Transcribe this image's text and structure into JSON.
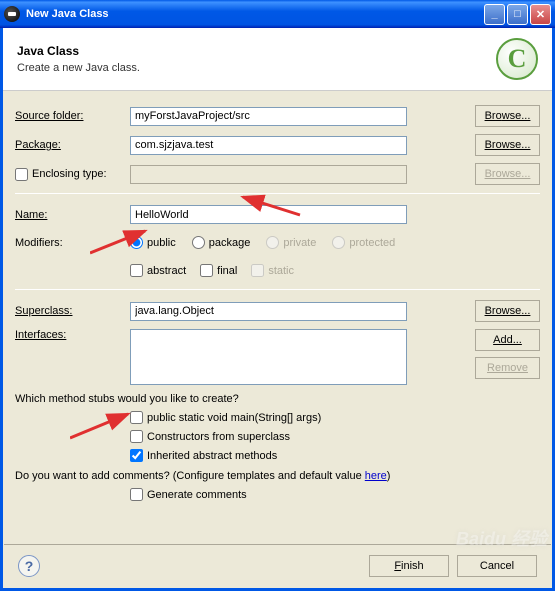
{
  "window": {
    "title": "New Java Class"
  },
  "header": {
    "title": "Java Class",
    "subtitle": "Create a new Java class."
  },
  "labels": {
    "sourceFolder": "Source folder:",
    "package": "Package:",
    "enclosingType": "Enclosing type:",
    "name": "Name:",
    "modifiers": "Modifiers:",
    "superclass": "Superclass:",
    "interfaces": "Interfaces:"
  },
  "fields": {
    "sourceFolder": "myForstJavaProject/src",
    "package": "com.sjzjava.test",
    "enclosingType": "",
    "name": "HelloWorld",
    "superclass": "java.lang.Object"
  },
  "buttons": {
    "browse": "Browse...",
    "add": "Add...",
    "remove": "Remove",
    "finish": "Finish",
    "cancel": "Cancel"
  },
  "modifiers": {
    "public": "public",
    "package": "package",
    "private": "private",
    "protected": "protected",
    "abstract": "abstract",
    "final": "final",
    "static": "static",
    "selected": "public",
    "abstractChecked": false,
    "finalChecked": false,
    "staticChecked": false
  },
  "stubs": {
    "question": "Which method stubs would you like to create?",
    "main": "public static void main(String[] args)",
    "mainChecked": false,
    "constructors": "Constructors from superclass",
    "constructorsChecked": false,
    "inherited": "Inherited abstract methods",
    "inheritedChecked": true
  },
  "comments": {
    "question_pre": "Do you want to add comments? (Configure templates and default value ",
    "link": "here",
    "question_post": ")",
    "generate": "Generate comments",
    "generateChecked": false
  },
  "enclosingTypeChecked": false,
  "watermark": "Baidu 经验"
}
